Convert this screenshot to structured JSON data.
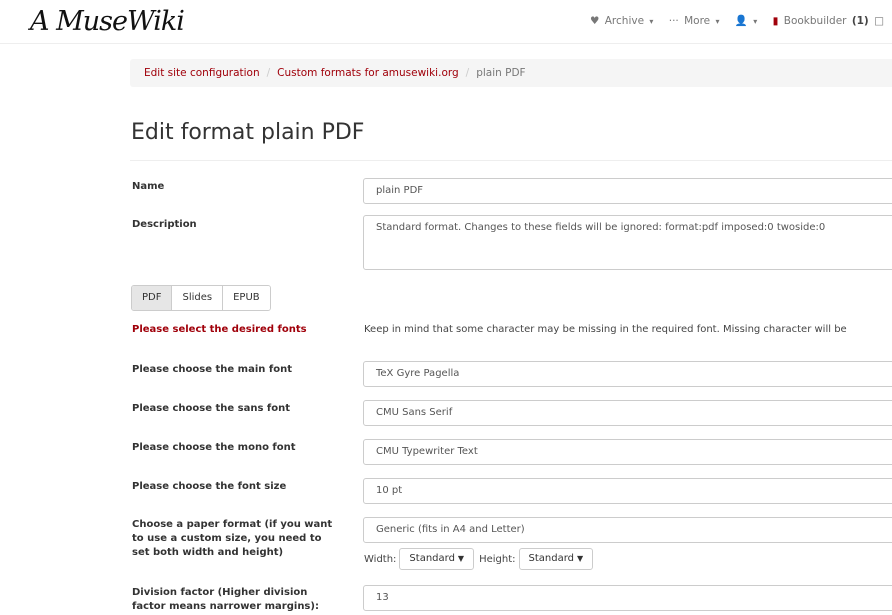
{
  "navbar": {
    "logo": "A MuseWiki",
    "archive": "Archive",
    "more": "More",
    "bookbuilder": "Bookbuilder",
    "bookbuilder_count": "(1)"
  },
  "breadcrumb": {
    "items": [
      "Edit site configuration",
      "Custom formats for amusewiki.org",
      "plain PDF"
    ]
  },
  "title": "Edit format plain PDF",
  "form": {
    "name_label": "Name",
    "name_value": "plain PDF",
    "description_label": "Description",
    "description_value": "Standard format. Changes to these fields will be ignored: format:pdf imposed:0 twoside:0",
    "tabs": [
      "PDF",
      "Slides",
      "EPUB"
    ],
    "fonts_label": "Please select the desired fonts",
    "fonts_help": "Keep in mind that some character may be missing in the required font. Missing character will be",
    "main_font_label": "Please choose the main font",
    "main_font_value": "TeX Gyre Pagella",
    "sans_font_label": "Please choose the sans font",
    "sans_font_value": "CMU Sans Serif",
    "mono_font_label": "Please choose the mono font",
    "mono_font_value": "CMU Typewriter Text",
    "font_size_label": "Please choose the font size",
    "font_size_value": "10 pt",
    "paper_label": "Choose a paper format (if you want to use a custom size, you need to set both width and height)",
    "paper_value": "Generic (fits in A4 and Letter)",
    "width_label": "Width:",
    "width_value": "Standard",
    "height_label": "Height:",
    "height_value": "Standard",
    "division_label": "Division factor (Higher division factor means narrower margins):",
    "division_value": "13"
  }
}
